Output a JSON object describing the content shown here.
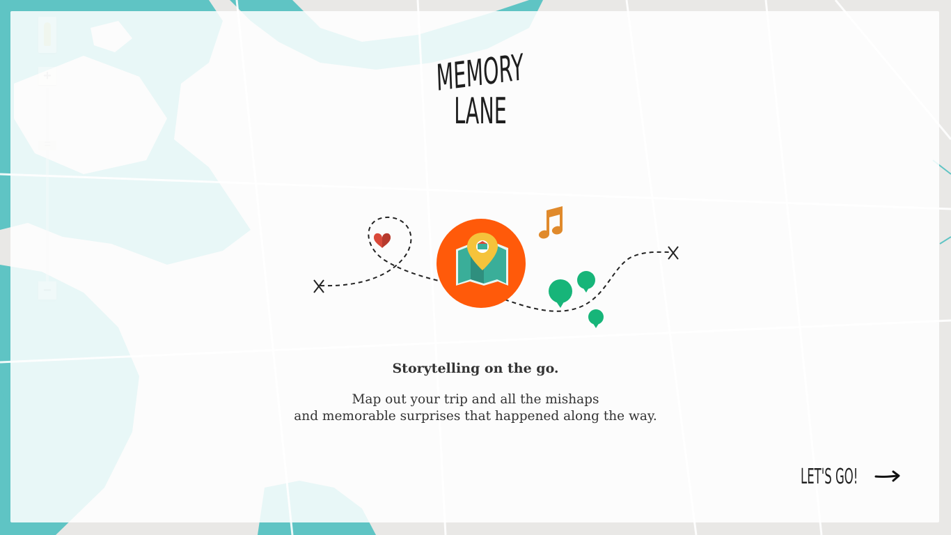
{
  "logo": {
    "line1": "MEMORY",
    "line2": "LANE"
  },
  "tagline": "Storytelling on the go.",
  "description": {
    "line1": "Map out your trip and all the mishaps",
    "line2": "and memorable surprises that happened along the way."
  },
  "cta": {
    "label": "LET'S GO!",
    "icon": "arrow-right-icon"
  },
  "map_controls": {
    "zoom_in": "+",
    "zoom_out": "−"
  },
  "colors": {
    "water": "#5fc4c4",
    "land": "#e9e8e6",
    "accent_orange": "#ff5a0a",
    "map_teal": "#3aae99",
    "pin_yellow": "#f5c33b",
    "note_orange": "#e08a2c",
    "bubble_green": "#17b579",
    "heart_red": "#d9493a"
  },
  "icons": [
    "pegman-icon",
    "heart-icon",
    "map-pin-icon",
    "music-note-icon",
    "speech-bubble-icon",
    "cross-marker-icon"
  ]
}
